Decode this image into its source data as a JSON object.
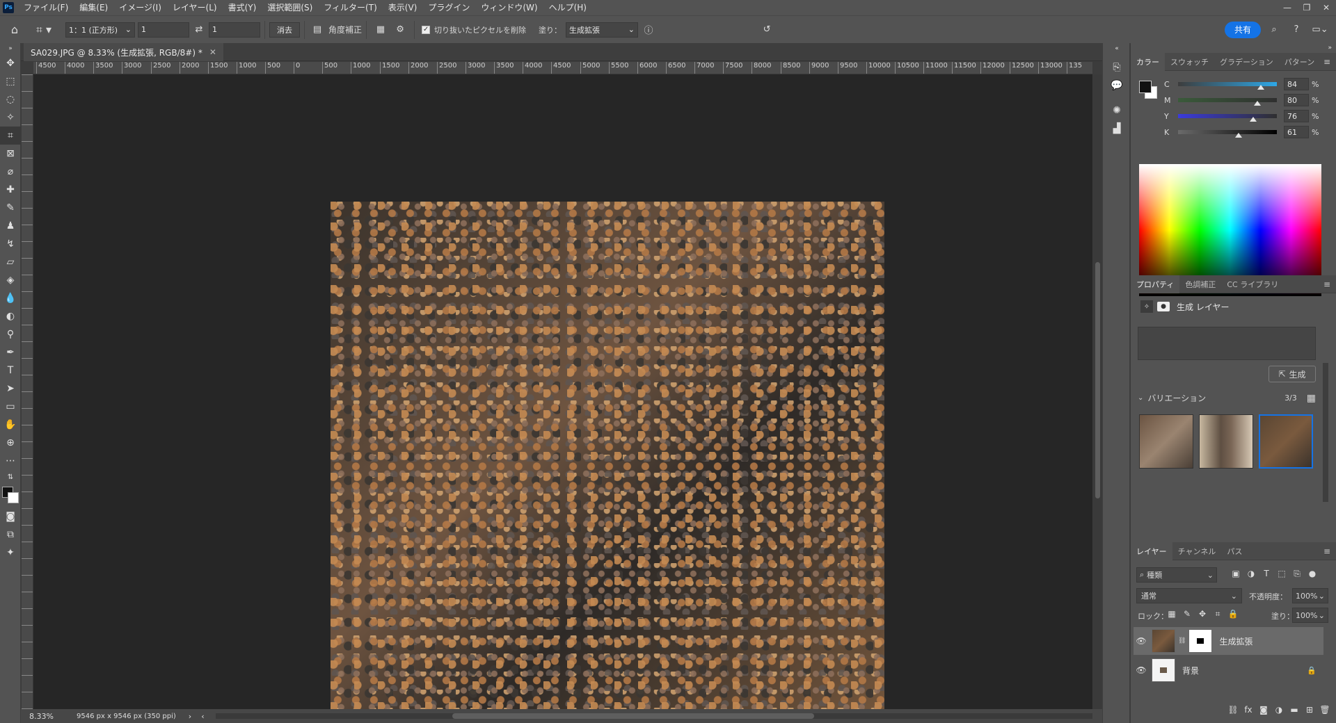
{
  "menubar": {
    "logo": "Ps",
    "items": [
      "ファイル(F)",
      "編集(E)",
      "イメージ(I)",
      "レイヤー(L)",
      "書式(Y)",
      "選択範囲(S)",
      "フィルター(T)",
      "表示(V)",
      "プラグイン",
      "ウィンドウ(W)",
      "ヘルプ(H)"
    ]
  },
  "options": {
    "ratio_preset": "1：1 (正方形)",
    "width_value": "1",
    "height_value": "1",
    "clear_label": "消去",
    "straighten_label": "角度補正",
    "delete_cropped_label": "切り抜いたピクセルを削除",
    "fill_label": "塗り：",
    "fill_value": "生成拡張",
    "share_label": "共有"
  },
  "document": {
    "tab_title": "SA029.JPG @ 8.33% (生成拡張, RGB/8#) *",
    "zoom": "8.33%",
    "dimensions": "9546 px x 9546 px (350 ppi)"
  },
  "ruler": {
    "h_ticks": [
      "4500",
      "4000",
      "3500",
      "3000",
      "2500",
      "2000",
      "1500",
      "1000",
      "500",
      "0",
      "500",
      "1000",
      "1500",
      "2000",
      "2500",
      "3000",
      "3500",
      "4000",
      "4500",
      "5000",
      "5500",
      "6000",
      "6500",
      "7000",
      "7500",
      "8000",
      "8500",
      "9000",
      "9500",
      "10000",
      "10500",
      "11000",
      "11500",
      "12000",
      "12500",
      "13000",
      "135"
    ]
  },
  "color_panel": {
    "tabs": [
      "カラー",
      "スウォッチ",
      "グラデーション",
      "パターン"
    ],
    "channels": [
      {
        "label": "C",
        "value": "84",
        "pct": 84,
        "grad": "linear-gradient(to right,#3d3d3d,#2ea7e6)"
      },
      {
        "label": "M",
        "value": "80",
        "pct": 80,
        "grad": "linear-gradient(to right,#3a5a3a,#2f2f2f)"
      },
      {
        "label": "Y",
        "value": "76",
        "pct": 76,
        "grad": "linear-gradient(to right,#3b3bdc,#2f2f2f)"
      },
      {
        "label": "K",
        "value": "61",
        "pct": 61,
        "grad": "linear-gradient(to right,#6a6a6a,#000)"
      }
    ],
    "percent": "%"
  },
  "properties_panel": {
    "tabs": [
      "プロパティ",
      "色調補正",
      "CC ライブラリ"
    ],
    "layer_type": "生成 レイヤー",
    "generate_label": "生成",
    "variations_label": "バリエーション",
    "variations_count": "3/3"
  },
  "layers_panel": {
    "tabs": [
      "レイヤー",
      "チャンネル",
      "パス"
    ],
    "filter_label": "種類",
    "blend_mode": "通常",
    "opacity_label": "不透明度：",
    "opacity_value": "100%",
    "lock_label": "ロック：",
    "fill_label": "塗り：",
    "fill_value": "100%",
    "layers": [
      {
        "name": "生成拡張"
      },
      {
        "name": "背景"
      }
    ]
  }
}
